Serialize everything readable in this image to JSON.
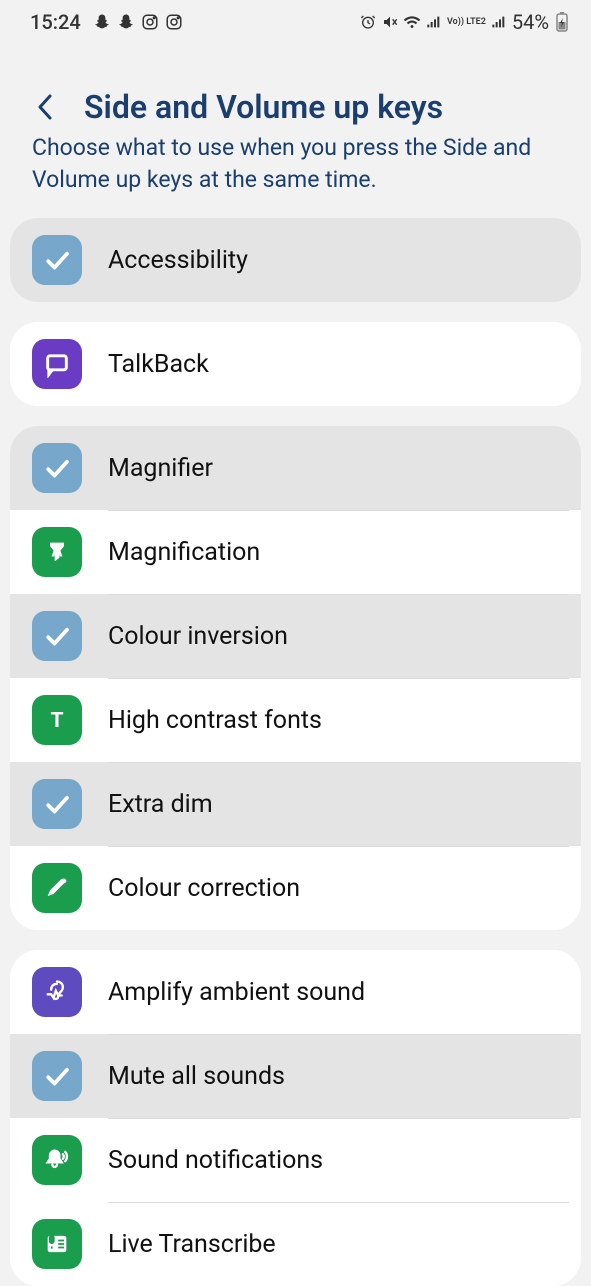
{
  "status": {
    "time": "15:24",
    "battery": "54%",
    "lte": "Vo)) LTE2"
  },
  "header": {
    "title": "Side and Volume up keys",
    "subtitle": "Choose what to use when you press the Side and Volume up keys at the same time."
  },
  "group1": {
    "accessibility": "Accessibility"
  },
  "group2": {
    "talkback": "TalkBack"
  },
  "group3": {
    "magnifier": "Magnifier",
    "magnification": "Magnification",
    "colour_inversion": "Colour inversion",
    "high_contrast": "High contrast fonts",
    "extra_dim": "Extra dim",
    "colour_correction": "Colour correction"
  },
  "group4": {
    "amplify": "Amplify ambient sound",
    "mute_all": "Mute all sounds",
    "sound_notif": "Sound notifications",
    "live_transcribe": "Live Transcribe"
  }
}
